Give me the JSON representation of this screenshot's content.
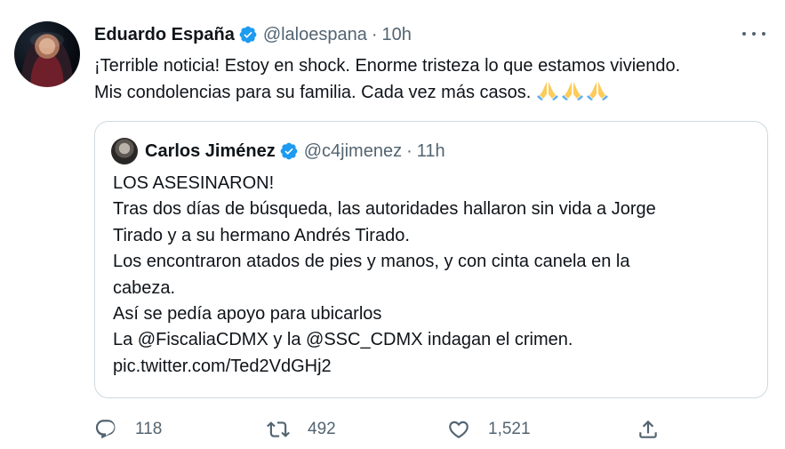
{
  "tweet": {
    "author_name": "Eduardo España",
    "author_handle": "@laloespana",
    "separator": "·",
    "time": "10h",
    "text_lines": [
      "¡Terrible noticia! Estoy en shock. Enorme tristeza lo que estamos viviendo.",
      "Mis condolencias para su familia. Cada vez más casos."
    ],
    "emoji": "folded-hands x3"
  },
  "quote": {
    "author_name": "Carlos Jiménez",
    "author_handle": "@c4jimenez",
    "separator": "·",
    "time": "11h",
    "text_lines": [
      "LOS ASESINARON!",
      "Tras dos días de búsqueda, las autoridades hallaron sin vida a Jorge",
      "Tirado y a su hermano Andrés Tirado.",
      "Los encontraron atados de pies y manos, y con cinta canela en la",
      "cabeza.",
      "Así se pedía apoyo para ubicarlos",
      "La @FiscaliaCDMX y la @SSC_CDMX indagan el crimen.",
      "pic.twitter.com/Ted2VdGHj2"
    ]
  },
  "actions": {
    "replies": "118",
    "retweets": "492",
    "likes": "1,521"
  },
  "icons": {
    "verified": "verified-badge-icon",
    "more": "more-options-icon",
    "reply": "reply-icon",
    "retweet": "retweet-icon",
    "like": "heart-icon",
    "share": "share-icon"
  },
  "colors": {
    "text": "#0f1419",
    "secondary": "#536471",
    "verified_blue": "#1d9bf0",
    "border": "#cfd9de"
  }
}
